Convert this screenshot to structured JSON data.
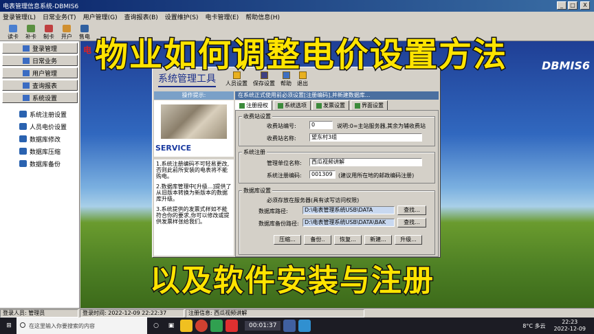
{
  "window": {
    "title": "电表管理信息系统-DBMIS6",
    "minimize": "_",
    "maximize": "□",
    "close": "X"
  },
  "menu": [
    "登录管理(L)",
    "日常业务(T)",
    "用户管理(G)",
    "查询报表(B)",
    "设置维护(S)",
    "电卡管理(E)",
    "帮助信息(H)"
  ],
  "toolbar": [
    "读卡",
    "补卡",
    "制卡",
    "开户",
    "售电"
  ],
  "nav": {
    "buttons": [
      "登录管理",
      "日常业务",
      "用户管理",
      "查询报表",
      "系统设置"
    ],
    "sub": [
      "系统注册设置",
      "人员电价设置",
      "数据库修改",
      "数据库压缩",
      "数据库备份"
    ]
  },
  "overlay": {
    "top": "物业如何调整电价设置方法",
    "bottom": "以及软件安装与注册"
  },
  "background": {
    "brand": "DBMIS6",
    "red_text": "电"
  },
  "dialog": {
    "title": "系统管理工具",
    "buttons": [
      "人员设置",
      "保存设置",
      "帮助",
      "退出"
    ],
    "op_title": "操作提示:",
    "hint": "在系统正式使用前必须设置[注册编码],并新建数据库...",
    "service": "SERVICE",
    "notes": [
      "1.系统注册编码不可轻易更改,否则此前所安装的电表将不能购电。",
      "2.数据库管理中[升级...]提供了从旧版本转换为新版本的数据库升级。",
      "3.系统提供的发票式样如不能符合你的要求,你可以修改或提供发票样张给我们。"
    ],
    "tabs": [
      "注册授权",
      "系统选项",
      "发票设置",
      "界面设置"
    ],
    "station": {
      "group": "收费站设置",
      "no_label": "收费站编号:",
      "no_value": "0",
      "no_note": "说明:0=主站服务器,其余为辅收费站",
      "name_label": "收费站名称:",
      "name_value": "望东村3组"
    },
    "register": {
      "group": "系统注册",
      "unit_label": "管理单位名称:",
      "unit_value": "西瓜视频讲解",
      "code_label": "系统注册编码:",
      "code_value": "001309",
      "code_note": "(建议用所在地的邮政编码注册)"
    },
    "db": {
      "group": "数据库设置",
      "note": "必须存放在服务器(具有读写访问权限)",
      "path_label": "数据库路径:",
      "path_value": "D:\\电表管理系统USB\\DATA",
      "bak_label": "数据库备份路径:",
      "bak_value": "D:\\电表管理系统USB\\DATA\\BAK",
      "find": "查找...",
      "find2": "查找...",
      "actions": [
        "压缩...",
        "备份..",
        "恢复...",
        "新建...",
        "升级..."
      ]
    }
  },
  "status": {
    "user": "登录人员: 管理员",
    "login_time": "登录时间: 2022-12-09 22:22:37",
    "reg": "注册信息: 西瓜视频讲解"
  },
  "taskbar": {
    "search": "在这里输入你要搜索的内容",
    "player_time": "00:01:37",
    "weather": "8°C 多云",
    "clock_time": "22:23",
    "clock_date": "2022-12-09"
  }
}
